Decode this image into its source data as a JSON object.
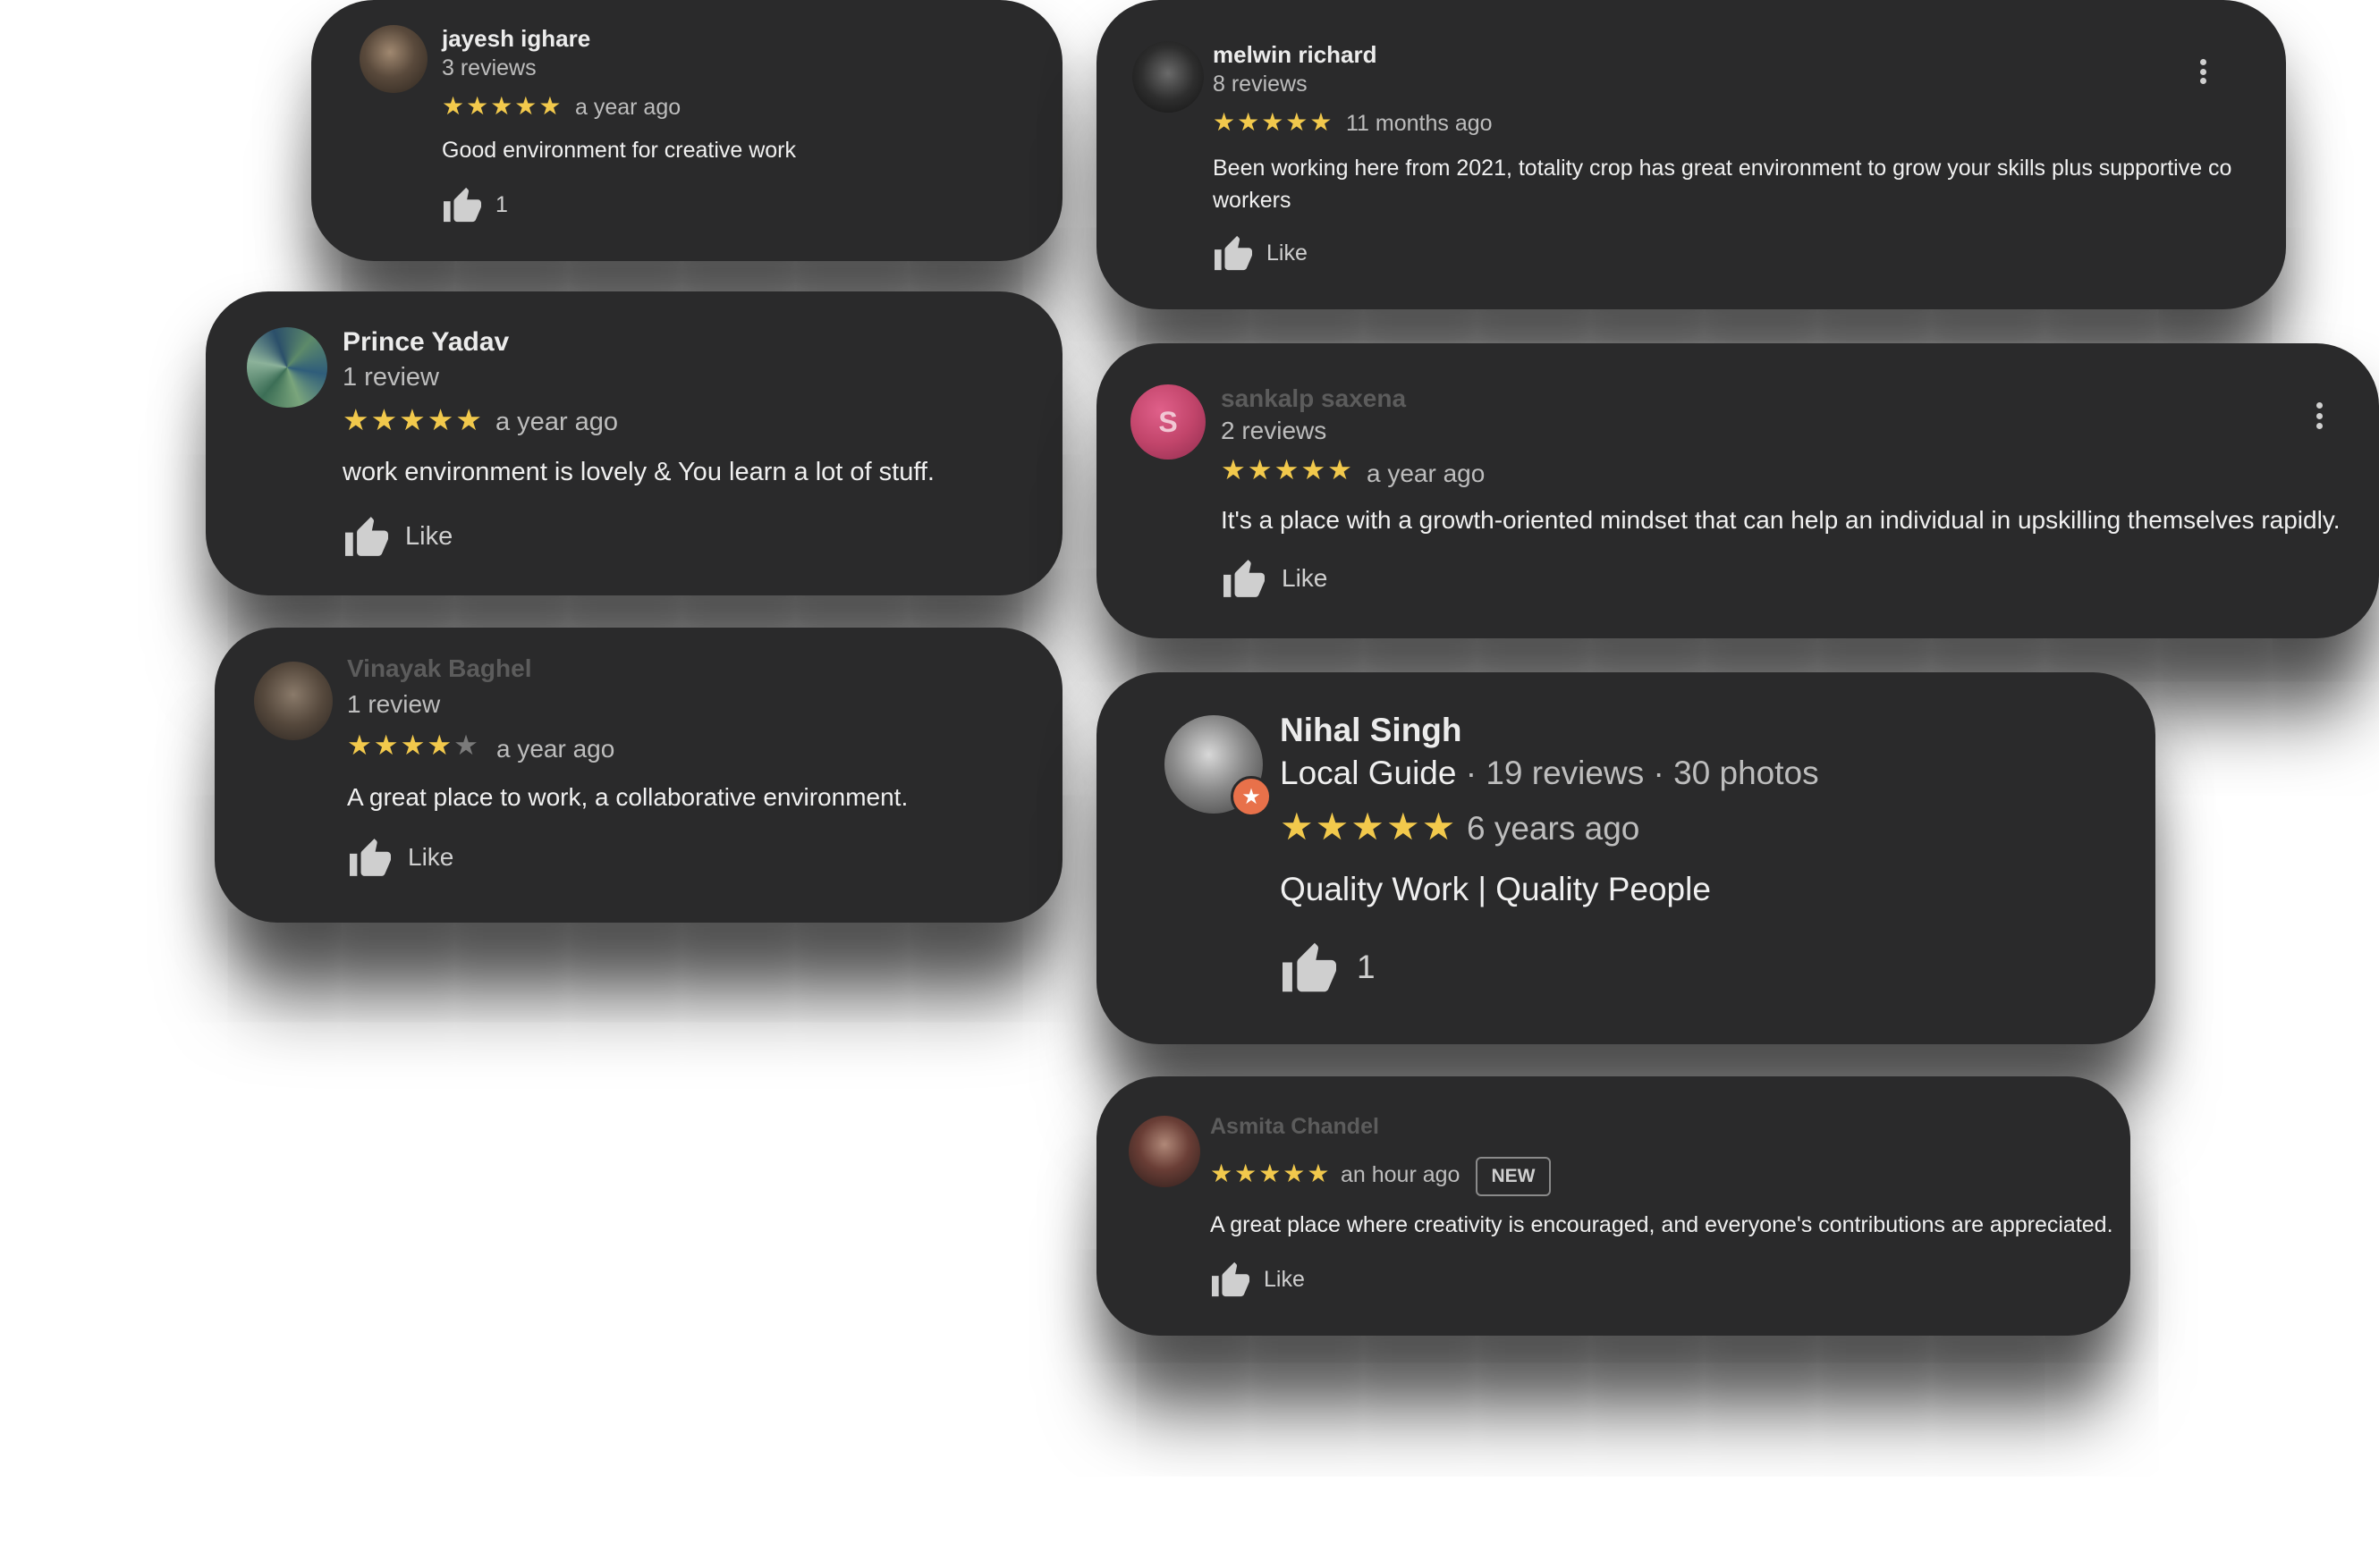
{
  "reviews": [
    {
      "id": "jayesh",
      "name": "jayesh ighare",
      "meta": "3 reviews",
      "rating": 5,
      "stars": "★★★★★",
      "time": "a year ago",
      "text": "Good environment for creative work",
      "like": "1"
    },
    {
      "id": "melwin",
      "name": "melwin richard",
      "meta": "8 reviews",
      "rating": 5,
      "stars": "★★★★★",
      "time": "11 months ago",
      "text": "Been working here from 2021, totality crop has great environment to grow your skills plus supportive  co workers",
      "like": "Like"
    },
    {
      "id": "prince",
      "name": "Prince Yadav",
      "meta": "1 review",
      "rating": 5,
      "stars": "★★★★★",
      "time": "a year ago",
      "text": "work environment is lovely & You learn a lot of stuff.",
      "like": "Like"
    },
    {
      "id": "sankalp",
      "name": "sankalp saxena",
      "avatar_letter": "S",
      "meta": "2 reviews",
      "rating": 5,
      "stars": "★★★★★",
      "time": "a year ago",
      "text": "It's a place with a growth-oriented mindset that can help an individual in upskilling themselves rapidly.",
      "like": "Like"
    },
    {
      "id": "vinayak",
      "name": "Vinayak Baghel",
      "meta": "1 review",
      "rating": 4,
      "stars_on": "★★★★",
      "stars_off": "★",
      "time": "a year ago",
      "text": "A great place to work, a collaborative environment.",
      "like": "Like"
    },
    {
      "id": "nihal",
      "name": "Nihal Singh",
      "guide": "Local Guide",
      "meta": " · 19 reviews · 30 photos",
      "rating": 5,
      "stars": "★★★★★",
      "time": "6 years ago",
      "text": "Quality Work | Quality People",
      "like": "1"
    },
    {
      "id": "asmita",
      "name": "Asmita Chandel",
      "rating": 5,
      "stars": "★★★★★",
      "time": "an hour ago",
      "badge": "NEW",
      "text": "A great place where creativity is encouraged, and everyone's contributions are appreciated.",
      "like": "Like"
    }
  ],
  "colors": {
    "card_bg": "#2a2a2b",
    "star": "#f2c94c",
    "sankalp_avatar": "#c2456b"
  }
}
